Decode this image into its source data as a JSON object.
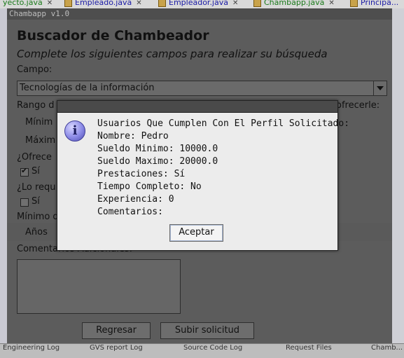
{
  "ide": {
    "tabs": [
      {
        "label": "yecto.java",
        "color": "#1a7a1a"
      },
      {
        "label": "Empleado.java",
        "color": "#1a1aa6"
      },
      {
        "label": "Empleador.java",
        "color": "#1a1aa6"
      },
      {
        "label": "Chambapp.java",
        "color": "#1a7a1a"
      },
      {
        "label": "Principa...",
        "color": "#1a1aa6"
      }
    ],
    "bottom": [
      "Engineering Log",
      "GVS report Log",
      "Source Code Log",
      "Request Files",
      "Chamb..."
    ]
  },
  "window": {
    "title": "Chambapp v1.0"
  },
  "form": {
    "title": "Buscador de Chambeador",
    "subtitle": "Complete los siguientes campos para realizar su búsqueda",
    "campo_label": "Campo:",
    "campo_value": "Tecnologías de la información",
    "rango_label": "Rango d",
    "ofrecer_label": "ofrecerle:",
    "minimo_label": "Mínim",
    "maximo_label": "Máxim",
    "ofrece_label": "¿Ofrece",
    "si1_label": "Sí",
    "si1_checked": true,
    "requiere_label": "¿Lo requ",
    "si2_label": "Sí",
    "si2_checked": false,
    "minimo_exp_label": "Mínimo d",
    "anos_label": "Años",
    "comentarios_label": "Comentarios Adicionales:",
    "regresar_label": "Regresar",
    "subir_label": "Subir solicitud"
  },
  "dialog": {
    "icon": "info-icon",
    "icon_glyph": "i",
    "lines": [
      "Usuarios Que Cumplen Con El Perfil Solicitado:",
      "Nombre: Pedro",
      "Sueldo Minimo: 10000.0",
      "Sueldo Maximo: 20000.0",
      "Prestaciones: Sí",
      "Tiempo Completo: No",
      "Experiencia: 0",
      "Comentarios:"
    ],
    "ok_label": "Aceptar"
  }
}
